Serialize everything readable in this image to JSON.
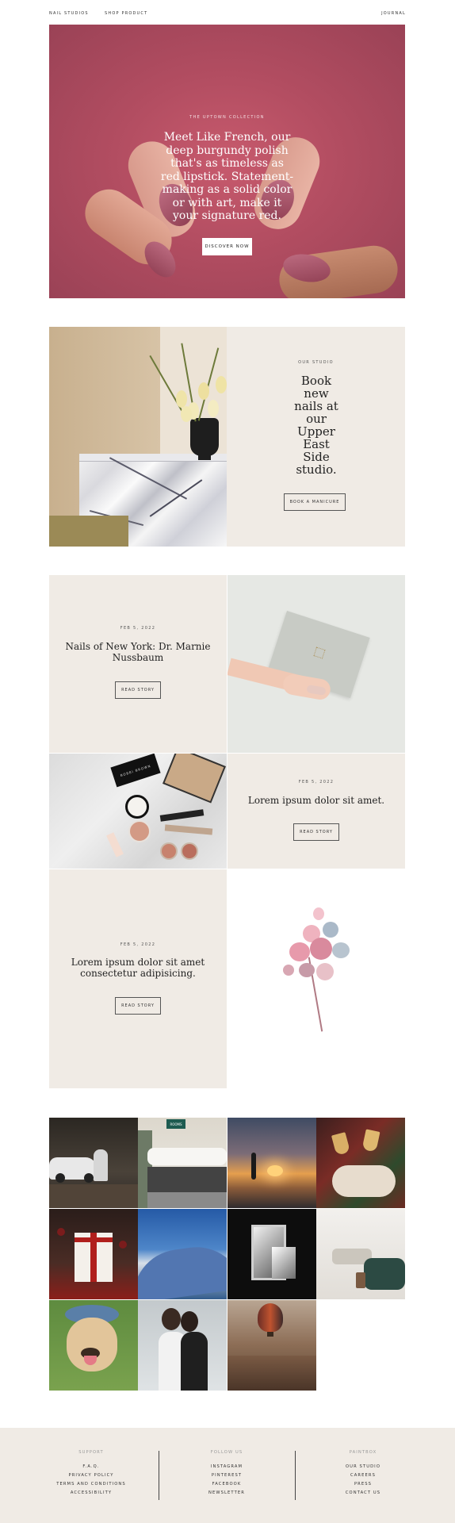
{
  "nav": {
    "brand": "NAIL STUDIOS",
    "shop": "SHOP PRODUCT",
    "journal": "JOURNAL"
  },
  "hero": {
    "eyebrow": "THE UPTOWN COLLECTION",
    "headline": "Meet Like French, our deep burgundy polish that's as timeless as red lipstick. Statement-making as a solid color or with art, make it your signature red.",
    "button": "DISCOVER NOW",
    "bg_color": "#b24d61"
  },
  "studio": {
    "eyebrow": "OUR STUDIO",
    "headline": "Book new nails at our Upper East Side studio.",
    "button": "BOOK A MANICURE"
  },
  "stories": [
    {
      "date": "FEB 5, 2022",
      "title": "Nails of New York: Dr. Marnie Nussbaum",
      "button": "READ STORY"
    },
    {
      "date": "FEB 5, 2022",
      "title": "Lorem ipsum dolor sit amet.",
      "button": "READ STORY"
    },
    {
      "date": "FEB 5, 2022",
      "title": "Lorem ipsum dolor sit amet consectetur adipisicing.",
      "button": "READ STORY"
    }
  ],
  "palette": "BOBBI BROWN",
  "photo_grid_sign": "ROOMS",
  "footer": {
    "support": {
      "heading": "SUPPORT",
      "links": [
        "F.A.Q.",
        "PRIVACY POLICY",
        "TERMS AND CONDITIONS",
        "ACCESSIBILITY"
      ]
    },
    "follow": {
      "heading": "FOLLOW US",
      "links": [
        "INSTAGRAM",
        "PINTEREST",
        "FACEBOOK",
        "NEWSLETTER"
      ]
    },
    "paintbox": {
      "heading": "PAINTBOX",
      "links": [
        "OUR STUDIO",
        "CAREERS",
        "PRESS",
        "CONTACT US"
      ]
    }
  }
}
